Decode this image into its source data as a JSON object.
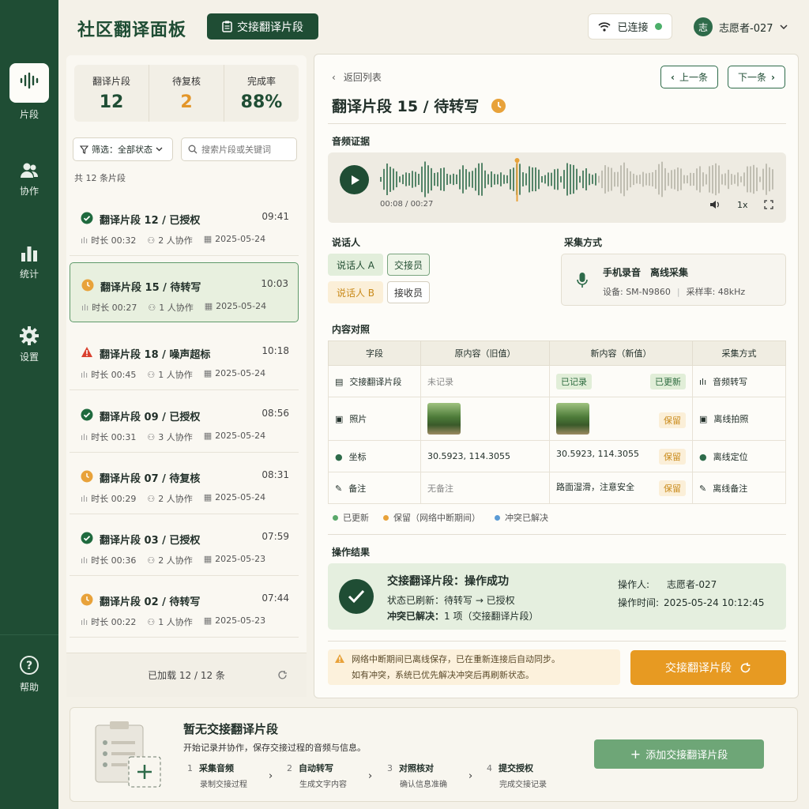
{
  "app": {
    "title": "社区翻译面板",
    "top_button": "交接翻译片段",
    "connection": "已连接",
    "user_avatar": "志",
    "user_name": "志愿者-027"
  },
  "sidebar": {
    "items": [
      {
        "label": "片段"
      },
      {
        "label": "协作"
      },
      {
        "label": "统计"
      },
      {
        "label": "设置"
      }
    ],
    "help": "帮助"
  },
  "stats": {
    "translated_label": "翻译片段",
    "translated_value": "12",
    "pending_label": "待复核",
    "pending_value": "2",
    "completion_label": "完成率",
    "completion_value": "88%"
  },
  "filter": {
    "label": "筛选：全部状态",
    "search_placeholder": "搜索片段或关键词"
  },
  "list": {
    "count": "共 12 条片段",
    "loaded": "已加载 12 / 12 条",
    "items": [
      {
        "title": "翻译片段 12 / 已授权",
        "time": "09:41",
        "duration": "时长 00:32",
        "collab": "2 人协作",
        "date": "2025-05-24",
        "status": "done"
      },
      {
        "title": "翻译片段 15 / 待转写",
        "time": "10:03",
        "duration": "时长 00:27",
        "collab": "1 人协作",
        "date": "2025-05-24",
        "status": "pending"
      },
      {
        "title": "翻译片段 18 / 噪声超标",
        "time": "10:18",
        "duration": "时长 00:45",
        "collab": "1 人协作",
        "date": "2025-05-24",
        "status": "warn"
      },
      {
        "title": "翻译片段 09 / 已授权",
        "time": "08:56",
        "duration": "时长 00:31",
        "collab": "3 人协作",
        "date": "2025-05-24",
        "status": "done"
      },
      {
        "title": "翻译片段 07 / 待复核",
        "time": "08:31",
        "duration": "时长 00:29",
        "collab": "2 人协作",
        "date": "2025-05-24",
        "status": "pending"
      },
      {
        "title": "翻译片段 03 / 已授权",
        "time": "07:59",
        "duration": "时长 00:36",
        "collab": "2 人协作",
        "date": "2025-05-23",
        "status": "done"
      },
      {
        "title": "翻译片段 02 / 待转写",
        "time": "07:44",
        "duration": "时长 00:22",
        "collab": "1 人协作",
        "date": "2025-05-23",
        "status": "pending"
      }
    ]
  },
  "detail": {
    "back": "返回列表",
    "prev": "上一条",
    "next": "下一条",
    "title": "翻译片段 15 / 待转写",
    "audio_label": "音频证据",
    "time_current": "00:08",
    "time_total": "00:27",
    "speed": "1x",
    "playback_progress": 0.3,
    "speaker_label": "说话人",
    "speaker_a": "说话人 A",
    "role_a": "交接员",
    "speaker_b": "说话人 B",
    "role_b": "接收员",
    "capture_label": "采集方式",
    "capture_method": "手机录音　离线采集",
    "device": "设备: SM-N9860",
    "sample_rate": "采样率: 48kHz",
    "compare_label": "内容对照",
    "table": {
      "headers": [
        "字段",
        "原内容（旧值）",
        "新内容（新值）",
        "采集方式"
      ],
      "rows": [
        {
          "field": "交接翻译片段",
          "old": "未记录",
          "new": "已记录",
          "tag": "已更新",
          "method": "音频转写"
        },
        {
          "field": "照片",
          "old": "",
          "new": "",
          "tag": "保留",
          "method": "离线拍照"
        },
        {
          "field": "坐标",
          "old": "30.5923, 114.3055",
          "new": "30.5923, 114.3055",
          "tag": "保留",
          "method": "离线定位"
        },
        {
          "field": "备注",
          "old": "无备注",
          "new": "路面湿滑，注意安全",
          "tag": "保留",
          "method": "离线备注"
        }
      ]
    },
    "legend": {
      "updated": "已更新",
      "kept": "保留（网络中断期间）",
      "resolved": "冲突已解决"
    },
    "colors": {
      "updated": "#5aa86a",
      "kept": "#e8a23a",
      "resolved": "#5b9bd5"
    },
    "result_label": "操作结果",
    "result_title": "交接翻译片段：操作成功",
    "result_line1": "状态已刷新：待转写 → 已授权",
    "result_line2_bold": "冲突已解决：",
    "result_line2": "1 项（交接翻译片段）",
    "operator_label": "操作人:",
    "operator": "志愿者-027",
    "optime_label": "操作时间:",
    "optime": "2025-05-24 10:12:45",
    "note_line1": "网络中断期间已离线保存，已在重新连接后自动同步。",
    "note_line2": "如有冲突，系统已优先解决冲突后再刷新状态。",
    "handover_button": "交接翻译片段"
  },
  "empty": {
    "title": "暂无交接翻译片段",
    "desc": "开始记录并协作，保存交接过程的音频与信息。",
    "add_button": "添加交接翻译片段",
    "steps": [
      {
        "n": "1",
        "h": "采集音频",
        "s": "录制交接过程"
      },
      {
        "n": "2",
        "h": "自动转写",
        "s": "生成文字内容"
      },
      {
        "n": "3",
        "h": "对照核对",
        "s": "确认信息准确"
      },
      {
        "n": "4",
        "h": "提交授权",
        "s": "完成交接记录"
      }
    ]
  }
}
